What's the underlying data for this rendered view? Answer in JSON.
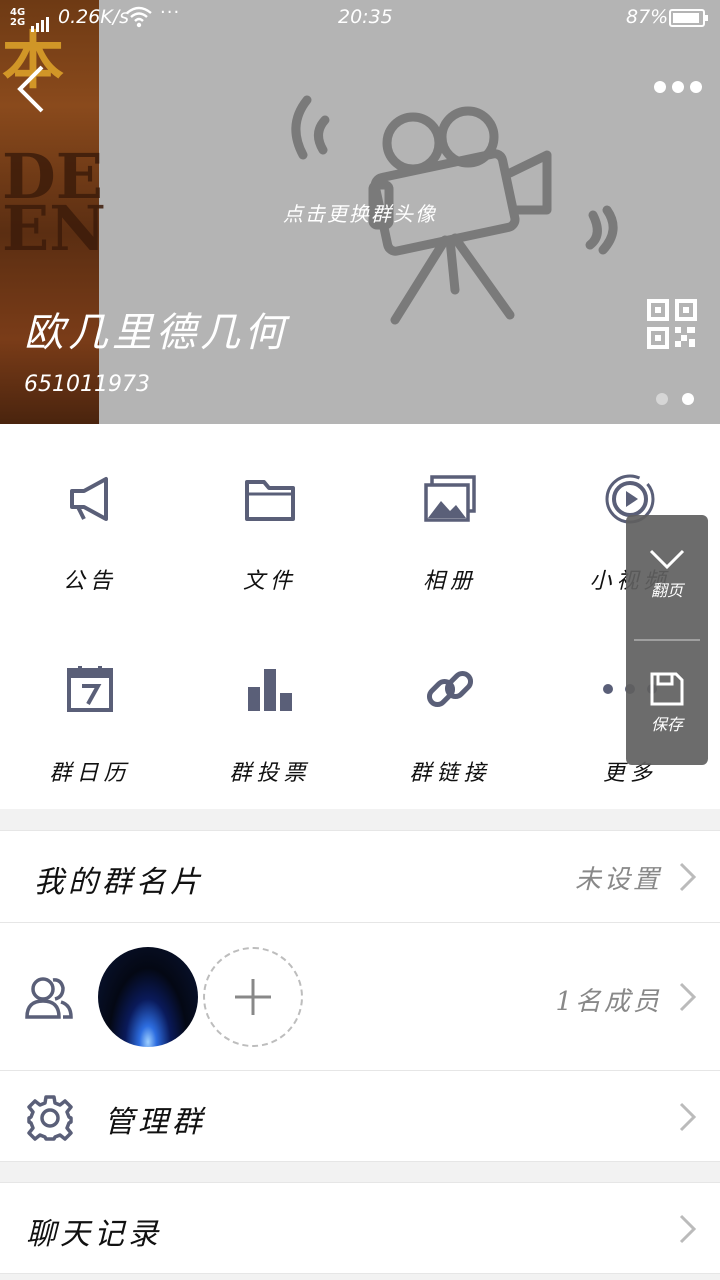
{
  "status_bar": {
    "network_top": "4G",
    "network_bottom": "2G",
    "speed": "0.26K/s",
    "more": "···",
    "time": "20:35",
    "battery": "87%"
  },
  "header": {
    "change_avatar_hint": "点击更换群头像",
    "group_name": "欧几里德几何",
    "group_id": "651011973",
    "photo_letters": [
      "本",
      "DE",
      "EN"
    ],
    "bg_color": "#b4b4b4",
    "page_count": 2,
    "active_page": 2
  },
  "features": [
    {
      "label": "公告",
      "icon": "megaphone-icon"
    },
    {
      "label": "文件",
      "icon": "folder-icon"
    },
    {
      "label": "相册",
      "icon": "photo-album-icon"
    },
    {
      "label": "小视频",
      "icon": "video-play-icon"
    },
    {
      "label": "群日历",
      "icon": "calendar-icon"
    },
    {
      "label": "群投票",
      "icon": "bar-chart-icon"
    },
    {
      "label": "群链接",
      "icon": "link-icon"
    },
    {
      "label": "更多",
      "icon": "more-dots-icon"
    }
  ],
  "float_panel": {
    "page_turn": "翻页",
    "save": "保存"
  },
  "list": {
    "card": {
      "title": "我的群名片",
      "value": "未设置"
    },
    "members": {
      "count": "1名成员"
    },
    "manage": {
      "title": "管理群"
    },
    "chat": {
      "title": "聊天记录"
    }
  },
  "colors": {
    "icon": "#5a5f78",
    "accent_white": "#ffffff",
    "muted_text": "#888888"
  }
}
